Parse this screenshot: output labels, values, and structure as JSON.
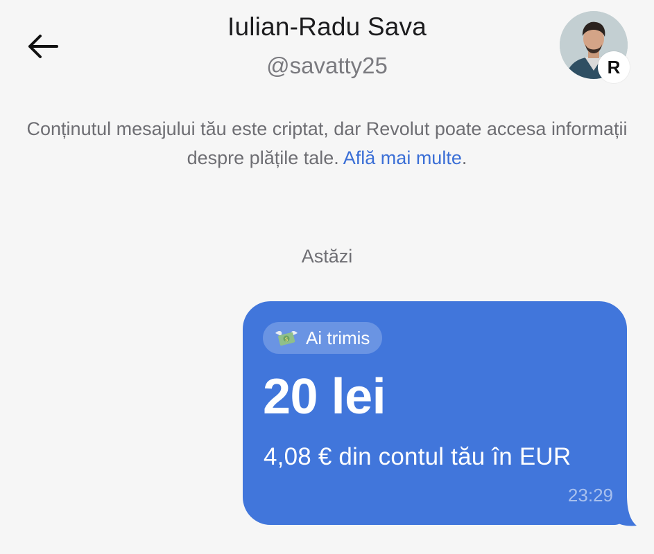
{
  "header": {
    "title": "Iulian-Radu Sava",
    "handle": "@savatty25",
    "back_icon": "arrow-left-icon",
    "avatar_badge": "R"
  },
  "notice": {
    "text": "Conținutul mesajului tău este criptat, dar Revolut poate accesa informații despre plățile tale. ",
    "link": "Află mai multe",
    "suffix": "."
  },
  "chat": {
    "date_separator": "Astăzi",
    "message": {
      "chip_icon": "money-with-wings-icon",
      "chip_label": "Ai trimis",
      "amount": "20 lei",
      "detail": "4,08 € din contul tău în EUR",
      "time": "23:29"
    }
  },
  "colors": {
    "bubble": "#4176db",
    "link": "#3b6fd6",
    "background": "#f6f6f6"
  }
}
